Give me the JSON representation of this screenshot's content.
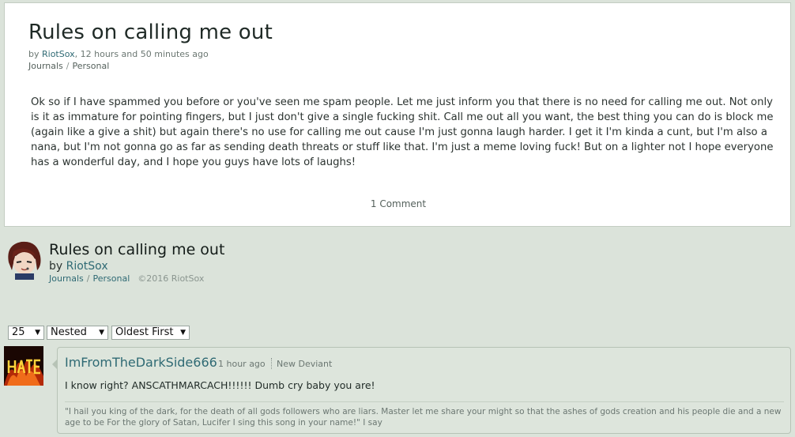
{
  "journal": {
    "title": "Rules on calling me out",
    "by_label": "by",
    "author": "RiotSox",
    "time": ", 12 hours and 50 minutes ago",
    "category1": "Journals",
    "category2": "Personal",
    "body": "Ok so if I have spammed you before or you've seen me spam people. Let me just inform you that there is no need for calling me out. Not only is it as immature for pointing fingers, but I just don't give a single fucking shit. Call me out all you want, the best thing you can do is block me (again like a give a shit) but again there's no use for calling me out cause I'm just gonna laugh harder. I get it I'm kinda a cunt, but I'm also a nana, but I'm not gonna go as far as sending death threats or stuff like that. I'm just a meme loving fuck! But on a lighter not I hope everyone has a wonderful day, and I hope you guys have lots of laughs!",
    "comment_count": "1 Comment"
  },
  "author_block": {
    "title": "Rules on calling me out",
    "by_label": "by",
    "author": "RiotSox",
    "category1": "Journals",
    "category2": "Personal",
    "copyright": "©2016 RiotSox",
    "avatar_icon": "cartoon-avatar-icon"
  },
  "controls": {
    "per_page": "25",
    "view_mode": "Nested",
    "sort": "Oldest First"
  },
  "comment": {
    "author": "ImFromTheDarkSide666",
    "time": "1 hour ago",
    "rank": "New Deviant",
    "text": "I know right? ANSCATHMARCACH!!!!!! Dumb cry baby you are!",
    "signature": "\"I hail you king of the dark, for the death of all gods followers who are liars. Master let me share your might so that the ashes of gods creation and his people die and a new age to be For the glory of Satan, Lucifer I sing this song in your name!\" I say",
    "avatar_icon": "hate-fire-avatar-icon"
  },
  "colors": {
    "page_bg": "#dbe3da",
    "link": "#2f6a74",
    "card_bg": "#ffffff"
  }
}
